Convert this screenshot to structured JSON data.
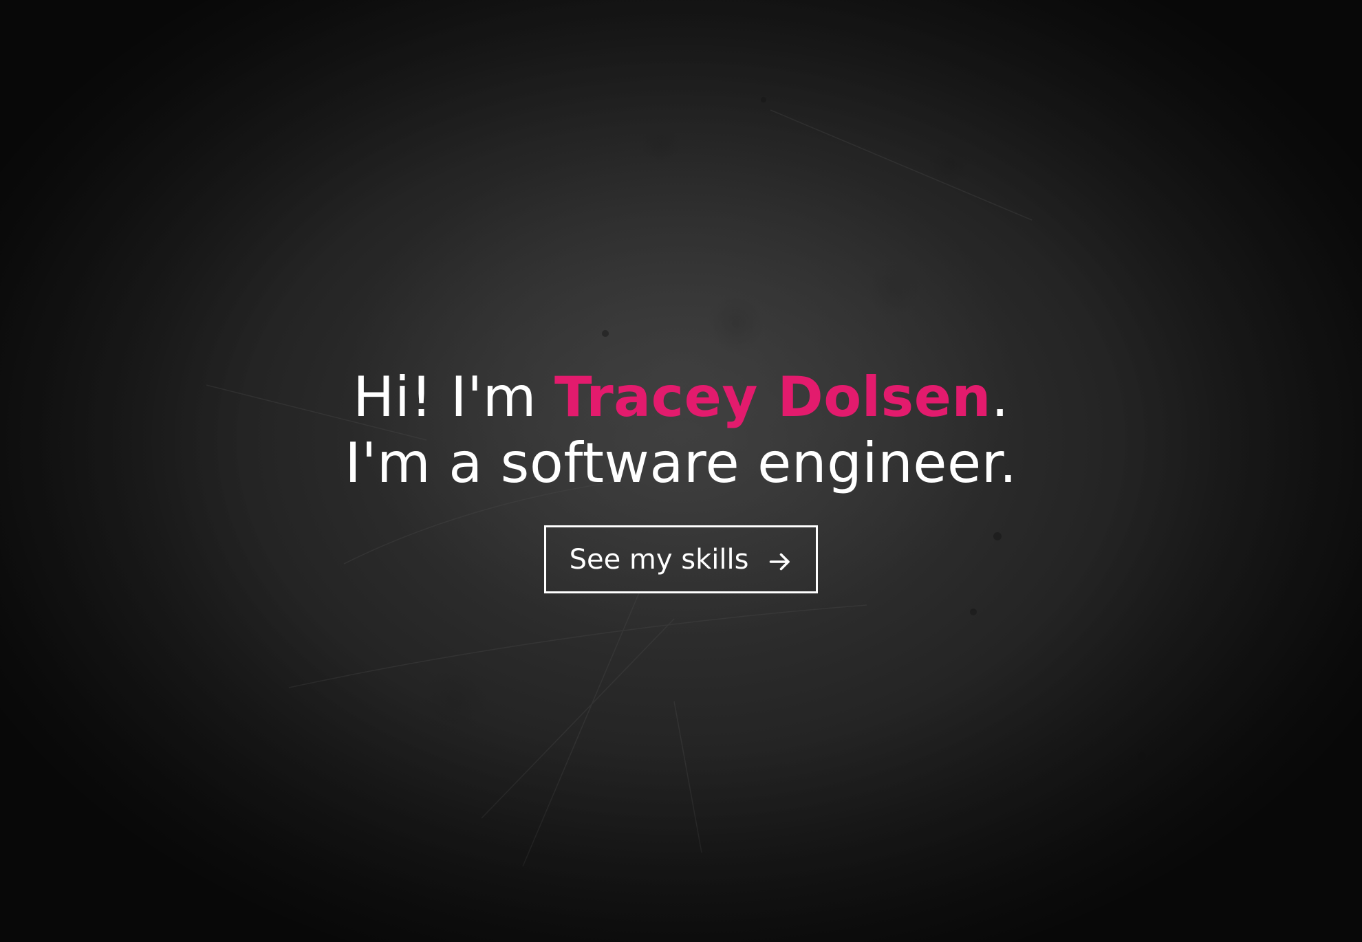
{
  "hero": {
    "greeting": "Hi! I'm ",
    "name": "Tracey Dolsen",
    "name_suffix": ".",
    "tagline": "I'm a software engineer.",
    "accent_color": "#e31b6d",
    "background_color": "#1c1c1c"
  },
  "cta": {
    "label": "See my skills",
    "icon": "arrow-right-icon"
  }
}
